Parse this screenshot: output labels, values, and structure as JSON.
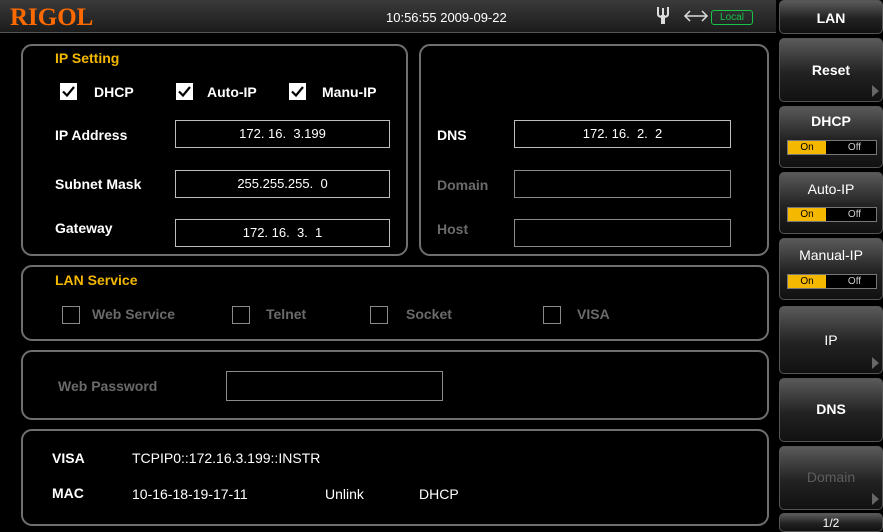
{
  "header": {
    "logo": "RIGOL",
    "datetime": "10:56:55 2009-09-22",
    "usb_icon": "usb-icon",
    "network_icon": "network-arrow-icon",
    "mode_badge": "Local"
  },
  "ip_setting": {
    "title": "IP Setting",
    "dhcp_label": "DHCP",
    "autoip_label": "Auto-IP",
    "manuip_label": "Manu-IP",
    "dhcp_checked": true,
    "autoip_checked": true,
    "manuip_checked": true,
    "ip_label": "IP Address",
    "ip_value": "172. 16.  3.199",
    "mask_label": "Subnet Mask",
    "mask_value": "255.255.255.  0",
    "gateway_label": "Gateway",
    "gateway_value": "172. 16.  3.  1"
  },
  "dns_setting": {
    "dns_label": "DNS",
    "dns_value": "172. 16.  2.  2",
    "domain_label": "Domain",
    "domain_value": "",
    "host_label": "Host",
    "host_value": ""
  },
  "lan_service": {
    "title": "LAN Service",
    "items": [
      "Web Service",
      "Telnet",
      "Socket",
      "VISA"
    ]
  },
  "web_password": {
    "label": "Web Password",
    "value": ""
  },
  "status": {
    "visa_label": "VISA",
    "visa_value": "TCPIP0::172.16.3.199::INSTR",
    "mac_label": "MAC",
    "mac_value": "10-16-18-19-17-11",
    "link_state": "Unlink",
    "mode": "DHCP"
  },
  "side_menu": {
    "title": "LAN",
    "reset": "Reset",
    "dhcp": "DHCP",
    "autoip": "Auto-IP",
    "manualip": "Manual-IP",
    "on_label": "On",
    "off_label": "Off",
    "ip": "IP",
    "dns": "DNS",
    "domain": "Domain",
    "page": "1/2"
  },
  "colors": {
    "accent": "#f5b800",
    "logo": "#ff6a00",
    "local_badge": "#19c34a"
  }
}
